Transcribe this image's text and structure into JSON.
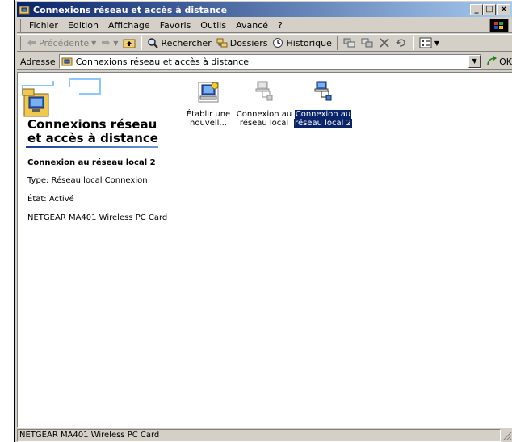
{
  "window": {
    "title": "Connexions réseau et accès à distance",
    "icon": "network-folder-icon",
    "buttons": {
      "minimize": "_",
      "maximize": "□",
      "close": "×"
    }
  },
  "menubar": {
    "items": [
      "Fichier",
      "Edition",
      "Affichage",
      "Favoris",
      "Outils",
      "Avancé",
      "?"
    ]
  },
  "toolbar": {
    "back_label": "Précédente",
    "forward_icon": "forward-arrow-icon",
    "up_icon": "up-folder-icon",
    "search_label": "Rechercher",
    "folders_label": "Dossiers",
    "history_label": "Historique"
  },
  "address": {
    "label": "Adresse",
    "value": "Connexions réseau et accès à distance",
    "go_label": "OK"
  },
  "webview": {
    "title_line1": "Connexions réseau",
    "title_line2": "et accès à distance",
    "selected_name": "Connexion au réseau local 2",
    "type_line": "Type: Réseau local Connexion",
    "state_line": "État: Activé",
    "device_line": "NETGEAR MA401 Wireless PC Card"
  },
  "items": [
    {
      "line1": "Établir une",
      "line2": "nouvell...",
      "icon": "new-connection-icon",
      "selected": false
    },
    {
      "line1": "Connexion au",
      "line2": "réseau local",
      "icon": "lan-connection-disabled-icon",
      "selected": false
    },
    {
      "line1": "Connexion au",
      "line2": "réseau local 2",
      "icon": "lan-connection-icon",
      "selected": true
    }
  ],
  "statusbar": {
    "text": "NETGEAR MA401 Wireless PC Card"
  },
  "colors": {
    "title_bar_start": "#0a246a",
    "title_bar_end": "#a6caf0",
    "selection": "#0a246a",
    "chrome": "#d4d0c8"
  }
}
